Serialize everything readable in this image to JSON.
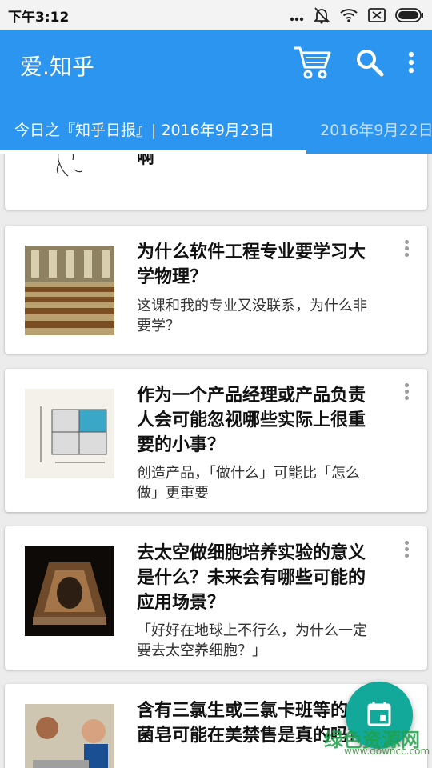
{
  "status_bar": {
    "time": "下午3:12",
    "icons": [
      "dots-icon",
      "mute-icon",
      "wifi-icon",
      "sim-icon",
      "battery-icon"
    ]
  },
  "app_bar": {
    "title": "爱.知乎",
    "actions": [
      "cart-icon",
      "search-icon",
      "more-vert-icon"
    ],
    "tabs": [
      {
        "label": "今日之『知乎日报』| 2016年9月23日",
        "active": true
      },
      {
        "label": "2016年9月22日",
        "active": false
      }
    ]
  },
  "feed": [
    {
      "title": "啊",
      "summary": "",
      "thumb": "sketch"
    },
    {
      "title": "为什么软件工程专业要学习大学物理？",
      "summary": "这课和我的专业又没联系，为什么非要学？",
      "thumb": "lecture-hall"
    },
    {
      "title": "作为一个产品经理或产品负责人会可能忽视哪些实际上很重要的小事？",
      "summary": "创造产品，「做什么」可能比「怎么做」更重要",
      "thumb": "quadrant-chart"
    },
    {
      "title": "去太空做细胞培养实验的意义是什么？未来会有哪些可能的应用场景？",
      "summary": "「好好在地球上不行么，为什么一定要去太空养细胞？」",
      "thumb": "space-capsule"
    },
    {
      "title": "含有三氯生或三氯卡班等的抗菌皂可能在美禁售是真的吗？",
      "summary": "",
      "thumb": "child-washing"
    }
  ],
  "fab": {
    "icon": "calendar-icon"
  },
  "watermark": {
    "text": "绿色资源网",
    "url": "www.downcc.com"
  },
  "colors": {
    "app_bar": "#2b95f0",
    "fab": "#12a89a",
    "background": "#ececec"
  }
}
